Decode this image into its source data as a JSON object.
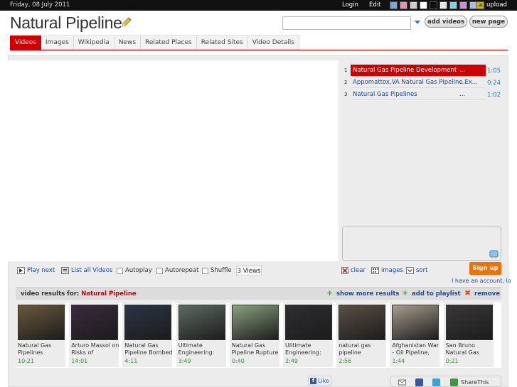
{
  "topbar": {
    "date": "Friday, 08 July 2011",
    "login": "Login",
    "edit": "Edit",
    "upload": "upload",
    "theme_swatches": [
      "#7aa7dc",
      "#f28cb8",
      "#cfcfcf",
      "#ffffff",
      "#111111",
      "#e9e9e9",
      "#7fd4e4",
      "#d987d9",
      "#a9bde4"
    ]
  },
  "header": {
    "title": "Natural Pipeline",
    "search_placeholder": "",
    "add_videos": "add videos",
    "new_page": "new page"
  },
  "tabs": [
    {
      "label": "Videos",
      "active": true
    },
    {
      "label": "Images",
      "active": false
    },
    {
      "label": "Wikipedia",
      "active": false
    },
    {
      "label": "News",
      "active": false
    },
    {
      "label": "Related Places",
      "active": false
    },
    {
      "label": "Related Sites",
      "active": false
    },
    {
      "label": "Video Details",
      "active": false
    }
  ],
  "playlist": [
    {
      "num": "1",
      "title": "Natural Gas Pipeline Development",
      "dots": "...",
      "duration": "1:05",
      "active": true
    },
    {
      "num": "2",
      "title": "Appomattox,VA Natural Gas Pipeline Ex...",
      "dots": "...",
      "duration": "0:24",
      "active": false
    },
    {
      "num": "3",
      "title": "Natural Gas Pipelines",
      "dots": "...",
      "duration": "1:02",
      "active": false
    }
  ],
  "controls": {
    "play_next": "Play next",
    "list_all": "List all Videos",
    "autoplay": "Autoplay",
    "autorepeat": "Autorepeat",
    "shuffle": "Shuffle",
    "views": "3 Views",
    "clear": "clear",
    "images": "images",
    "sort": "sort",
    "signup": "Sign up",
    "account": "I have an account, lo"
  },
  "results": {
    "label": "video results for:",
    "query": "Natural Pipeline",
    "show_more": "show more results",
    "add_to_playlist": "add to playlist",
    "remove": "remove"
  },
  "videos": [
    {
      "title": "Natural Gas Pipelines",
      "duration": "10:21",
      "thumb": "#6b5a3c"
    },
    {
      "title": "Arturo Massol on Risks of",
      "duration": "14:01",
      "thumb": "#3a2a3e"
    },
    {
      "title": "Natural Gas Pipeline Bombed",
      "duration": "4:11",
      "thumb": "#2c3446"
    },
    {
      "title": "Ultimate Engineering:",
      "duration": "3:49",
      "thumb": "#5d6a62"
    },
    {
      "title": "Natural Gas Pipeline Rupture",
      "duration": "0:40",
      "thumb": "#8aa17e"
    },
    {
      "title": "Ulltimate Engineering:",
      "duration": "2:49",
      "thumb": "#2e2e33"
    },
    {
      "title": "natural gas pipeline",
      "duration": "2:56",
      "thumb": "#5b4f44"
    },
    {
      "title": "Afghanistan War - Oil Pipeline,",
      "duration": "1:44",
      "thumb": "#a89c8c"
    },
    {
      "title": "San Bruno Natural Gas",
      "duration": "0:21",
      "thumb": "#3a3838"
    }
  ],
  "footer": {
    "like": "Like",
    "share": "ShareThis"
  }
}
